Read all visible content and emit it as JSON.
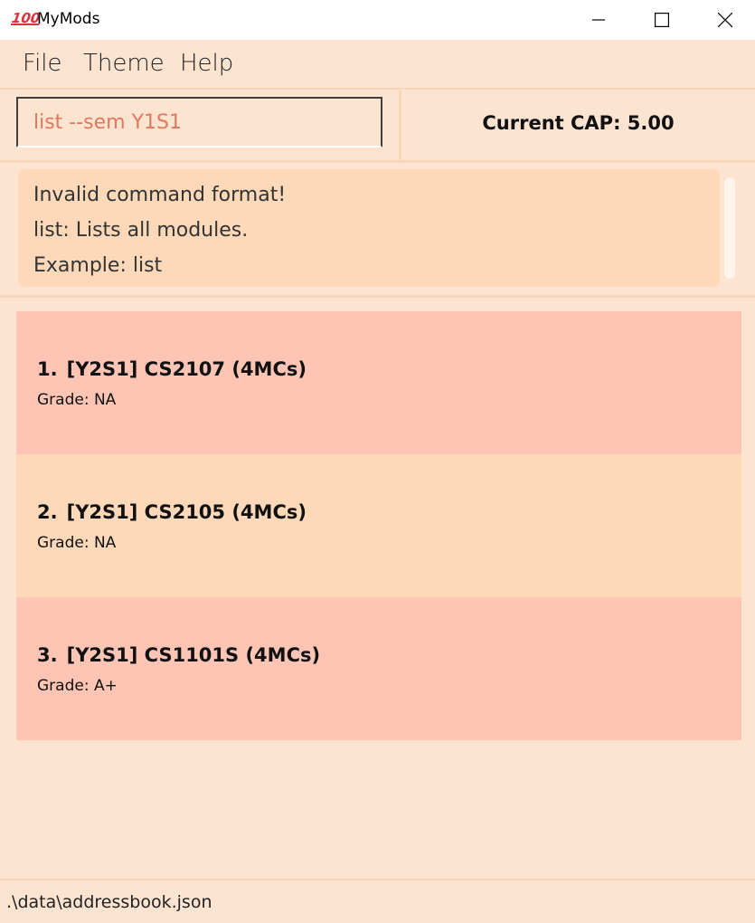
{
  "window": {
    "title": "MyMods",
    "app_icon": "hundred-points-icon",
    "controls": [
      "minimize-icon",
      "maximize-icon",
      "close-icon"
    ]
  },
  "menu": {
    "file": "File",
    "theme": "Theme",
    "help": "Help"
  },
  "command": {
    "value": "list --sem Y1S1"
  },
  "cap": {
    "label": "Current CAP: 5.00"
  },
  "result": {
    "lines": [
      "Invalid command format!",
      "list: Lists all modules.",
      "Example: list"
    ]
  },
  "modules": [
    {
      "index": "1.",
      "title": "[Y2S1] CS2107 (4MCs)",
      "grade": "Grade: NA",
      "color": "#fec5b4"
    },
    {
      "index": "2.",
      "title": "[Y2S1] CS2105 (4MCs)",
      "grade": "Grade: NA",
      "color": "#fdd9ba"
    },
    {
      "index": "3.",
      "title": "[Y2S1] CS1101S (4MCs)",
      "grade": "Grade: A+",
      "color": "#fec5b4"
    }
  ],
  "status": {
    "path": ".\\data\\addressbook.json"
  },
  "colors": {
    "background": "#fde4d0",
    "card_red": "#fec5b4",
    "card_orange": "#fdd9ba",
    "command_text": "#e07860"
  }
}
